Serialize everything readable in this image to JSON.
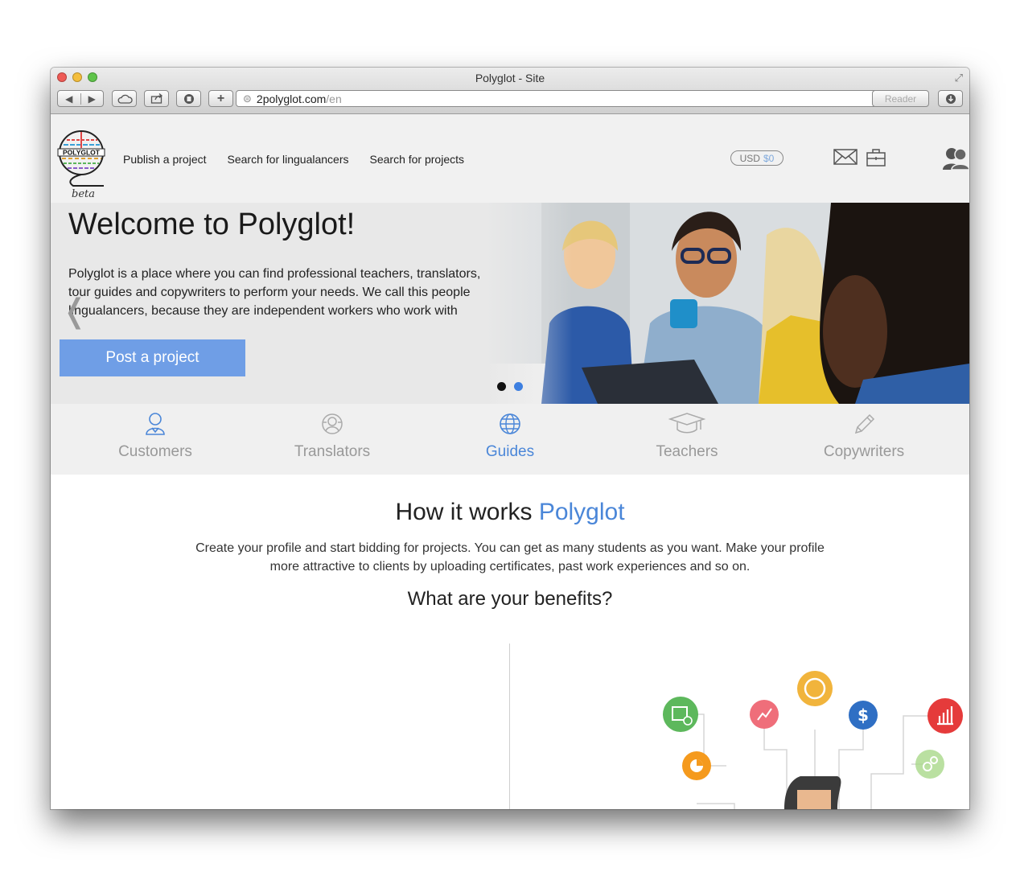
{
  "browser": {
    "title": "Polyglot - Site",
    "url_host": "2polyglot.com",
    "url_path": "/en",
    "reader_label": "Reader"
  },
  "header": {
    "logo_text": "POLYGLOT",
    "beta": "beta",
    "nav": [
      "Publish a project",
      "Search for lingualancers",
      "Search for projects"
    ],
    "currency": "USD",
    "balance": "$0"
  },
  "hero": {
    "title": "Welcome to Polyglot!",
    "text": "Polyglot is a place where you can find professional teachers, translators, tour guides and copywriters to perform your needs. We call this people lingualancers, because they are independent workers who work with",
    "button": "Post a project",
    "arrow": "❬"
  },
  "categories": [
    {
      "label": "Customers",
      "icon": "user-icon"
    },
    {
      "label": "Translators",
      "icon": "translator-icon"
    },
    {
      "label": "Guides",
      "icon": "globe-icon"
    },
    {
      "label": "Teachers",
      "icon": "graduation-cap-icon"
    },
    {
      "label": "Copywriters",
      "icon": "pen-icon"
    }
  ],
  "how": {
    "title_prefix": "How it works",
    "title_brand": "Polyglot",
    "description": "Create your profile and start bidding for projects. You can get as many students as you want. Make your profile more attractive to clients by uploading certificates, past work experiences and so on.",
    "benefits": "What are your benefits?"
  },
  "colors": {
    "accent": "#4a86d8",
    "button": "#6f9ee6",
    "inactive": "#999999"
  }
}
